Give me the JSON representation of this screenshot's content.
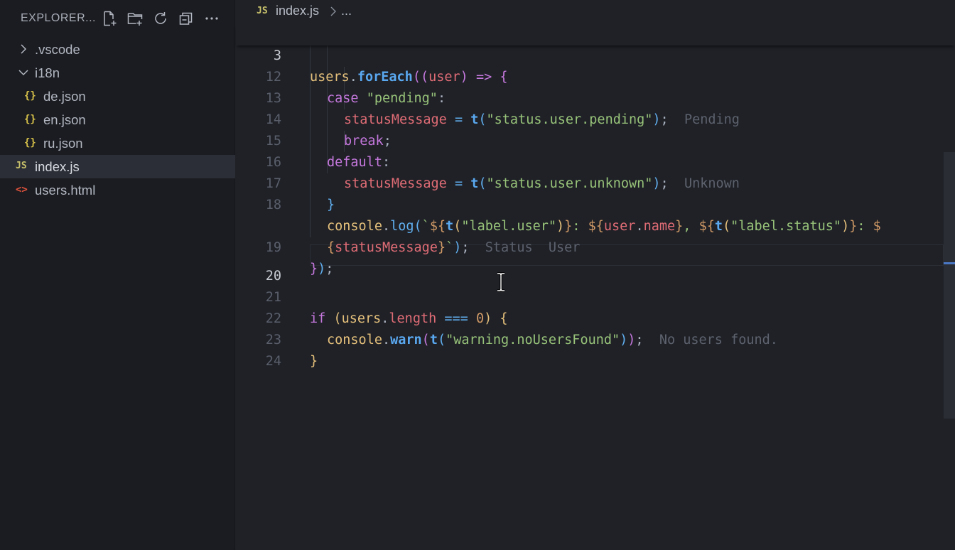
{
  "sidebar": {
    "title": "EXPLORER...",
    "actions": [
      {
        "name": "new-file-icon"
      },
      {
        "name": "new-folder-icon"
      },
      {
        "name": "refresh-icon"
      },
      {
        "name": "collapse-all-icon"
      },
      {
        "name": "more-icon"
      }
    ],
    "items": [
      {
        "label": ".vscode",
        "type": "folder",
        "expanded": false
      },
      {
        "label": "i18n",
        "type": "folder",
        "expanded": true
      },
      {
        "label": "de.json",
        "type": "json",
        "icon_text": "{}"
      },
      {
        "label": "en.json",
        "type": "json",
        "icon_text": "{}"
      },
      {
        "label": "ru.json",
        "type": "json",
        "icon_text": "{}"
      },
      {
        "label": "index.js",
        "type": "js",
        "icon_text": "JS",
        "selected": true
      },
      {
        "label": "users.html",
        "type": "html",
        "icon_text": "<>"
      }
    ]
  },
  "breadcrumb": {
    "icon_text": "JS",
    "file": "index.js",
    "more": "..."
  },
  "editor": {
    "sticky": {
      "ln": "3",
      "code": "users.forEach((user) => {"
    },
    "lines": [
      {
        "ln": "12"
      },
      {
        "ln": "13",
        "hint": "Pending"
      },
      {
        "ln": "14"
      },
      {
        "ln": "15"
      },
      {
        "ln": "16",
        "hint": "Unknown"
      },
      {
        "ln": "17"
      },
      {
        "ln": "18"
      },
      {
        "ln": "",
        "hint1": "Status",
        "hint2": "User"
      },
      {
        "ln": "19"
      },
      {
        "ln": "20",
        "active": true
      },
      {
        "ln": "21"
      },
      {
        "ln": "22",
        "hint": "No users found."
      },
      {
        "ln": "23"
      },
      {
        "ln": "24"
      }
    ],
    "tokens": {
      "users": "users",
      "forEach": "forEach",
      "user": "user",
      "arrow": "=>",
      "case": "case",
      "pending": "\"pending\"",
      "statusMessage": "statusMessage",
      "t": "t",
      "status_user_pending": "\"status.user.pending\"",
      "break": "break",
      "default": "default",
      "status_user_unknown": "\"status.user.unknown\"",
      "console": "console",
      "log": "log",
      "label_user": "\"label.user\"",
      "name": "name",
      "label_status": "\"label.status\"",
      "if": "if",
      "length": "length",
      "strict_eq": "===",
      "zero": "0",
      "warn": "warn",
      "warning_noUsersFound": "\"warning.noUsersFound\""
    }
  }
}
